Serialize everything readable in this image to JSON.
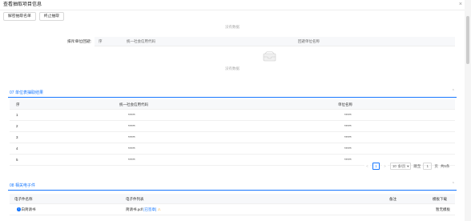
{
  "window": {
    "title": "查看抽取项目信息",
    "close_icon": "×"
  },
  "toolbar": {
    "btn1": "解密抽取名单",
    "btn2": "终止抽取"
  },
  "top_empty": "没有数据",
  "exclude": {
    "label": "排斥单位回避:",
    "col_index": "序",
    "col_code": "统一社会信用代码",
    "col_name": "回避单位名称",
    "empty": "没有数据"
  },
  "section_result": {
    "title": "07 单位表抽取结果",
    "columns": [
      "序",
      "统一社会信用代码",
      "单位名称"
    ],
    "rows": [
      [
        "1",
        "*****",
        "*****"
      ],
      [
        "2",
        "*****",
        "*****"
      ],
      [
        "3",
        "*****",
        "*****"
      ],
      [
        "4",
        "*****",
        "*****"
      ],
      [
        "5",
        "*****",
        "*****"
      ]
    ]
  },
  "pager": {
    "prev": "<",
    "page1": "1",
    "next": ">",
    "page_size": "10",
    "page_size_unit": "条/页",
    "goto_label": "跳至",
    "goto_value": "1",
    "page_unit": "页",
    "total": "共5条"
  },
  "section_files": {
    "title": "08 相关电子件",
    "columns": [
      "电子件名称",
      "电子件列表",
      "备注",
      "模板下载"
    ],
    "row": {
      "name": "白简请书",
      "file": "简请书.pdf",
      "preview": "[已签章]",
      "download": "暂无模板"
    }
  }
}
